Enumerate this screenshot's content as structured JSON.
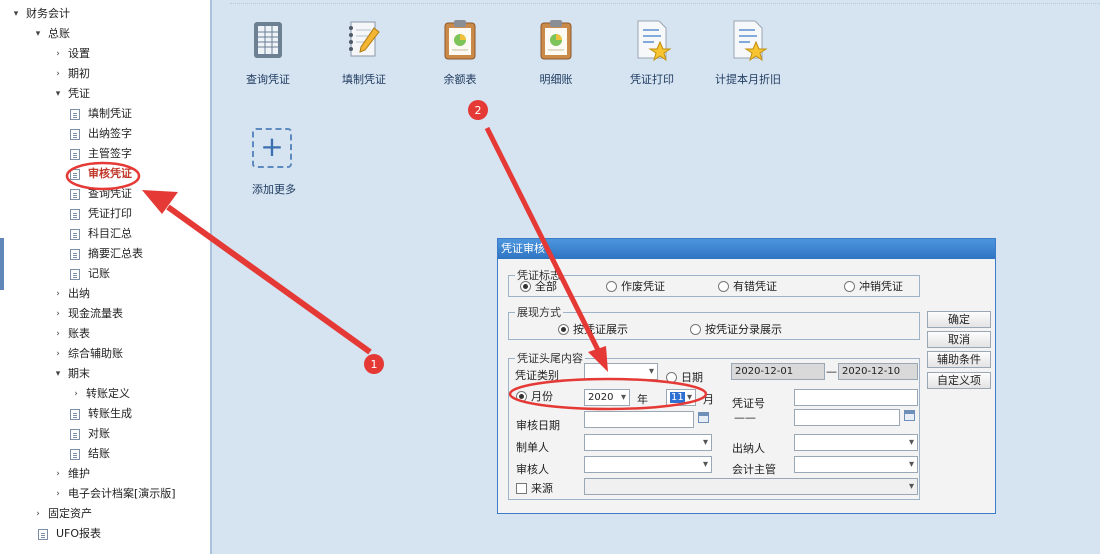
{
  "sidebar": {
    "items": [
      {
        "label": "财务会计",
        "toggle": "▾",
        "icon": "",
        "active": false
      },
      {
        "label": "总账",
        "toggle": "▾",
        "icon": "",
        "active": false
      },
      {
        "label": "设置",
        "toggle": "›",
        "icon": "",
        "active": false
      },
      {
        "label": "期初",
        "toggle": "›",
        "icon": "",
        "active": false
      },
      {
        "label": "凭证",
        "toggle": "▾",
        "icon": "",
        "active": false
      },
      {
        "label": "填制凭证",
        "toggle": "",
        "icon": "doc",
        "active": false
      },
      {
        "label": "出纳签字",
        "toggle": "",
        "icon": "doc",
        "active": false
      },
      {
        "label": "主管签字",
        "toggle": "",
        "icon": "doc",
        "active": false
      },
      {
        "label": "审核凭证",
        "toggle": "",
        "icon": "doc",
        "active": true
      },
      {
        "label": "查询凭证",
        "toggle": "",
        "icon": "doc",
        "active": false
      },
      {
        "label": "凭证打印",
        "toggle": "",
        "icon": "doc",
        "active": false
      },
      {
        "label": "科目汇总",
        "toggle": "",
        "icon": "doc",
        "active": false
      },
      {
        "label": "摘要汇总表",
        "toggle": "",
        "icon": "doc",
        "active": false
      },
      {
        "label": "记账",
        "toggle": "",
        "icon": "doc",
        "active": false
      },
      {
        "label": "出纳",
        "toggle": "›",
        "icon": "",
        "active": false
      },
      {
        "label": "现金流量表",
        "toggle": "›",
        "icon": "",
        "active": false
      },
      {
        "label": "账表",
        "toggle": "›",
        "icon": "",
        "active": false
      },
      {
        "label": "综合辅助账",
        "toggle": "›",
        "icon": "",
        "active": false
      },
      {
        "label": "期末",
        "toggle": "▾",
        "icon": "",
        "active": false
      },
      {
        "label": "转账定义",
        "toggle": "›",
        "icon": "",
        "active": false
      },
      {
        "label": "转账生成",
        "toggle": "",
        "icon": "doc",
        "active": false
      },
      {
        "label": "对账",
        "toggle": "",
        "icon": "doc",
        "active": false
      },
      {
        "label": "结账",
        "toggle": "",
        "icon": "doc",
        "active": false
      },
      {
        "label": "维护",
        "toggle": "›",
        "icon": "",
        "active": false
      },
      {
        "label": "电子会计档案[演示版]",
        "toggle": "›",
        "icon": "",
        "active": false
      },
      {
        "label": "固定资产",
        "toggle": "›",
        "icon": "",
        "active": false
      },
      {
        "label": "UFO报表",
        "toggle": "",
        "icon": "doc",
        "active": false
      }
    ]
  },
  "apps": [
    {
      "label": "查询凭证",
      "icon": "ledger-icon"
    },
    {
      "label": "填制凭证",
      "icon": "notebook-pen-icon"
    },
    {
      "label": "余额表",
      "icon": "clipboard-chart-icon"
    },
    {
      "label": "明细账",
      "icon": "clipboard-chart-icon"
    },
    {
      "label": "凭证打印",
      "icon": "document-star-icon"
    },
    {
      "label": "计提本月折旧",
      "icon": "document-star-icon"
    }
  ],
  "add_more": {
    "symbol": "+",
    "label": "添加更多"
  },
  "dialog": {
    "title": "凭证审核",
    "voucher_mark": {
      "legend": "凭证标志",
      "options": [
        "全部",
        "作废凭证",
        "有错凭证",
        "冲销凭证"
      ],
      "selected": "全部"
    },
    "display_mode": {
      "legend": "展现方式",
      "options": [
        "按凭证展示",
        "按凭证分录展示"
      ],
      "selected": "按凭证展示"
    },
    "header_tail": {
      "legend": "凭证头尾内容",
      "voucher_type_label": "凭证类别",
      "voucher_type_value": "",
      "date_label": "日期",
      "date_from": "2020-12-01",
      "date_dash": "—",
      "date_to": "2020-12-10",
      "month_label": "月份",
      "year_value": "2020",
      "year_unit": "年",
      "month_value": "11",
      "month_unit": "月",
      "voucher_no_label": "凭证号",
      "voucher_no_dash": "——",
      "audit_date_label": "审核日期",
      "maker_label": "制单人",
      "cashier_label": "出纳人",
      "auditor_label": "审核人",
      "supervisor_label": "会计主管",
      "source_label": "来源"
    },
    "buttons": {
      "ok": "确定",
      "cancel": "取消",
      "aux": "辅助条件",
      "custom": "自定义项"
    }
  },
  "annotations": {
    "step1": "1",
    "step2": "2",
    "color": "#e53935"
  }
}
